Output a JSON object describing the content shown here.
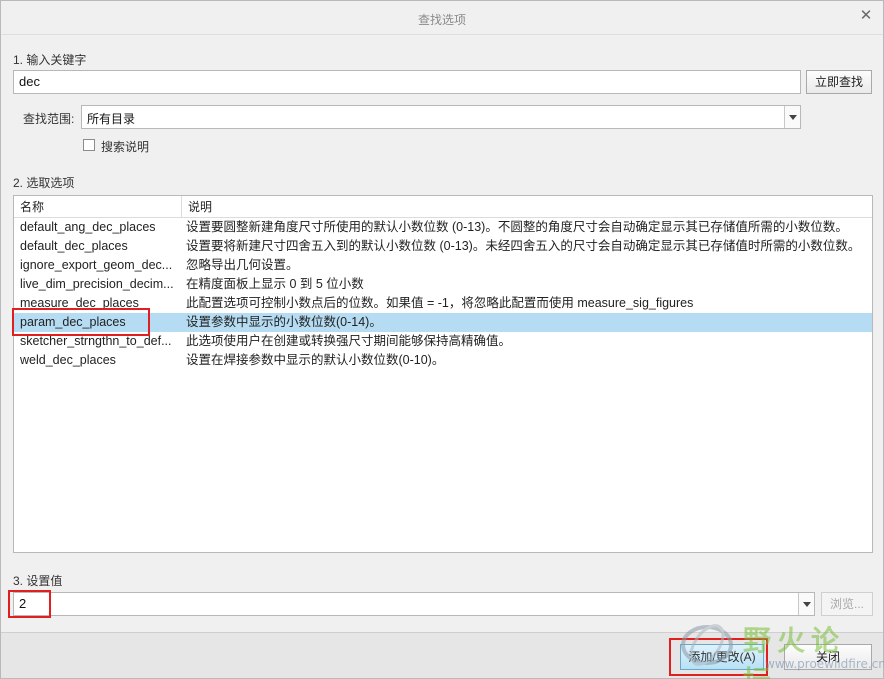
{
  "window": {
    "title": "查找选项"
  },
  "section1": {
    "label": "1. 输入关键字"
  },
  "keyword": {
    "value": "dec"
  },
  "buttons": {
    "search_now": "立即查找",
    "browse": "浏览...",
    "add_change": "添加/更改(A)",
    "close": "关闭"
  },
  "scope": {
    "label": "查找范围:",
    "selected": "所有目录"
  },
  "search_desc": {
    "label": "搜索说明",
    "checked": false
  },
  "section2": {
    "label": "2. 选取选项"
  },
  "table": {
    "headers": [
      "名称",
      "说明"
    ],
    "rows": [
      {
        "name": "default_ang_dec_places",
        "desc": "设置要圆整新建角度尺寸所使用的默认小数位数 (0-13)。不圆整的角度尺寸会自动确定显示其已存储值所需的小数位数。"
      },
      {
        "name": "default_dec_places",
        "desc": "设置要将新建尺寸四舍五入到的默认小数位数 (0-13)。未经四舍五入的尺寸会自动确定显示其已存储值时所需的小数位数。"
      },
      {
        "name": "ignore_export_geom_dec...",
        "desc": "忽略导出几何设置。"
      },
      {
        "name": "live_dim_precision_decim...",
        "desc": "在精度面板上显示 0 到 5 位小数"
      },
      {
        "name": "measure_dec_places",
        "desc": "此配置选项可控制小数点后的位数。如果值 = -1，将忽略此配置而使用 measure_sig_figures"
      },
      {
        "name": "param_dec_places",
        "desc": "设置参数中显示的小数位数(0-14)。"
      },
      {
        "name": "sketcher_strngthn_to_def...",
        "desc": "此选项使用户在创建或转换强尺寸期间能够保持高精确值。"
      },
      {
        "name": "weld_dec_places",
        "desc": "设置在焊接参数中显示的默认小数位数(0-10)。"
      }
    ],
    "selected_index": 5
  },
  "section3": {
    "label": "3. 设置值"
  },
  "setting_value": {
    "value": "2"
  },
  "watermark": {
    "text": "野火论坛",
    "url": "www.proewildfire.cn"
  }
}
